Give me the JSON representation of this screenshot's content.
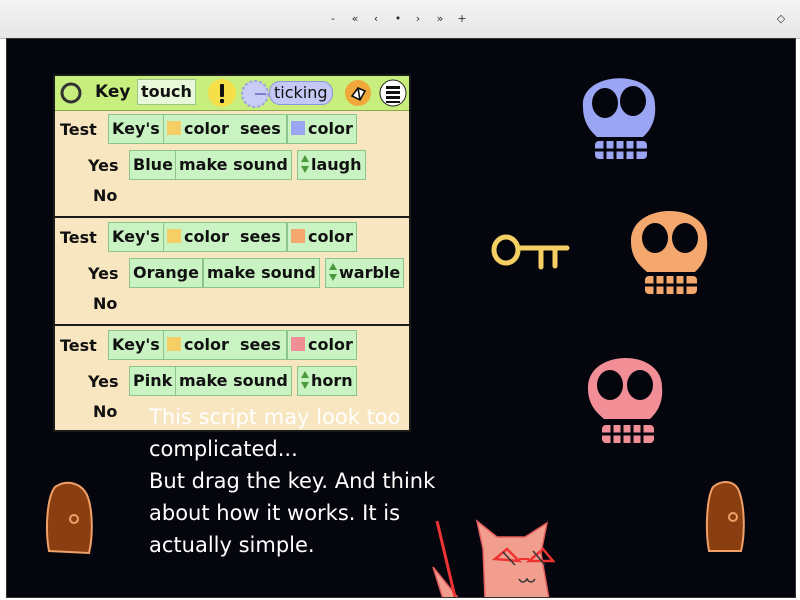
{
  "navbar": {
    "buttons": [
      {
        "name": "minimize-nav-button",
        "glyph": "-"
      },
      {
        "name": "first-page-button",
        "glyph": "«"
      },
      {
        "name": "prev-page-button",
        "glyph": "‹"
      },
      {
        "name": "home-page-button",
        "glyph": "•"
      },
      {
        "name": "next-page-button",
        "glyph": "›"
      },
      {
        "name": "last-page-button",
        "glyph": "»"
      },
      {
        "name": "add-page-button",
        "glyph": "+"
      }
    ],
    "menu_glyph": "◇"
  },
  "script_header": {
    "object_name": "Key",
    "trigger": "touch",
    "alert_glyph": "!",
    "status": "ticking"
  },
  "tests": [
    {
      "test_label": "Test",
      "subject": "Key's",
      "color_word": "color",
      "sees": "sees",
      "target_word": "color",
      "yes_label": "Yes",
      "skull_name": "Blue",
      "action": "make sound",
      "sound": "laugh",
      "no_label": "No",
      "key_color": "#f5cf63",
      "target_color": "#9aa6f3"
    },
    {
      "test_label": "Test",
      "subject": "Key's",
      "color_word": "color",
      "sees": "sees",
      "target_word": "color",
      "yes_label": "Yes",
      "skull_name": "Orange",
      "action": "make sound",
      "sound": "warble",
      "no_label": "No",
      "key_color": "#f5cf63",
      "target_color": "#f5a86e"
    },
    {
      "test_label": "Test",
      "subject": "Key's",
      "color_word": "color",
      "sees": "sees",
      "target_word": "color",
      "yes_label": "Yes",
      "skull_name": "Pink",
      "action": "make sound",
      "sound": "horn",
      "no_label": "No",
      "key_color": "#f5cf63",
      "target_color": "#f28e95"
    }
  ],
  "message": {
    "lines": [
      "This script may look too",
      "complicated...",
      "But drag the key. And think",
      "about  how it works. It is",
      "actually simple."
    ]
  },
  "colors": {
    "world_bg": "#05050d",
    "script_bg": "#f7e6c0",
    "header_bg": "#c8ef7e",
    "tile_bg": "#c9f3c2",
    "blue_skull": "#9aa6f3",
    "orange_skull": "#f5a86e",
    "pink_skull": "#f28e95",
    "key": "#f5cf63",
    "door": "#8a3f10",
    "door_outline": "#f0a068",
    "cat": "#f29e8e"
  }
}
